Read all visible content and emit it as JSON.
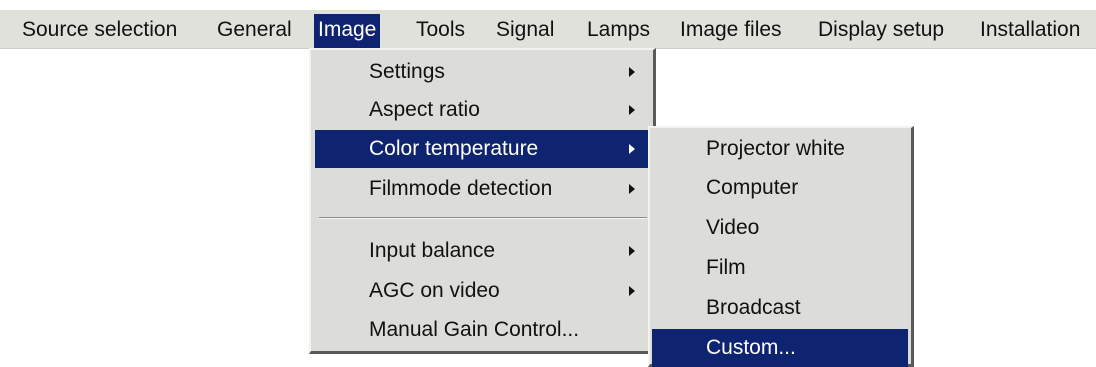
{
  "menubar": {
    "items": [
      {
        "label": "Source selection"
      },
      {
        "label": "General"
      },
      {
        "label": "Image"
      },
      {
        "label": "Tools"
      },
      {
        "label": "Signal"
      },
      {
        "label": "Lamps"
      },
      {
        "label": "Image files"
      },
      {
        "label": "Display setup"
      },
      {
        "label": "Installation"
      }
    ],
    "active": "Image"
  },
  "image_menu": {
    "items": [
      {
        "label": "Settings",
        "has_submenu": true
      },
      {
        "label": "Aspect ratio",
        "has_submenu": true
      },
      {
        "label": "Color temperature",
        "has_submenu": true,
        "active": true
      },
      {
        "label": "Filmmode detection",
        "has_submenu": true
      },
      {
        "label": "Input balance",
        "has_submenu": true
      },
      {
        "label": "AGC on video",
        "has_submenu": true
      },
      {
        "label": "Manual Gain Control...",
        "has_submenu": false
      }
    ]
  },
  "color_temperature_menu": {
    "items": [
      {
        "label": "Projector white"
      },
      {
        "label": "Computer"
      },
      {
        "label": "Video"
      },
      {
        "label": "Film"
      },
      {
        "label": "Broadcast"
      },
      {
        "label": "Custom...",
        "active": true
      }
    ]
  },
  "colors": {
    "highlight": "#0f2470",
    "menu_background": "#dcdcd8",
    "menubar_background": "#e1e1dc"
  },
  "icons": {
    "submenu_arrow": "right-triangle"
  }
}
